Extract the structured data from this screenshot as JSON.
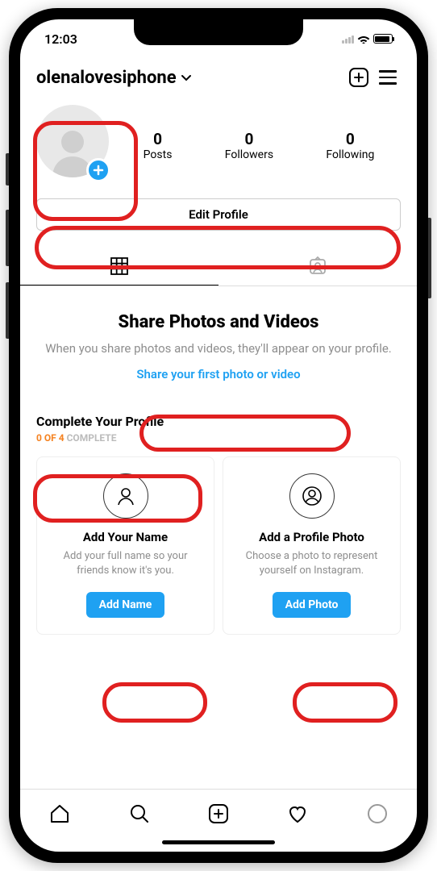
{
  "status": {
    "time": "12:03"
  },
  "header": {
    "username": "olenalovesiphone"
  },
  "stats": {
    "posts_count": "0",
    "posts_label": "Posts",
    "followers_count": "0",
    "followers_label": "Followers",
    "following_count": "0",
    "following_label": "Following"
  },
  "edit_profile_label": "Edit Profile",
  "empty": {
    "title": "Share Photos and Videos",
    "subtitle": "When you share photos and videos, they'll appear on your profile.",
    "link": "Share your first photo or video"
  },
  "complete": {
    "title": "Complete Your Profile",
    "progress_highlight": "0 OF 4",
    "progress_rest": " COMPLETE"
  },
  "cards": [
    {
      "title": "Add Your Name",
      "subtitle": "Add your full name so your friends know it's you.",
      "button": "Add Name"
    },
    {
      "title": "Add a Profile Photo",
      "subtitle": "Choose a photo to represent yourself on Instagram.",
      "button": "Add Photo"
    }
  ]
}
